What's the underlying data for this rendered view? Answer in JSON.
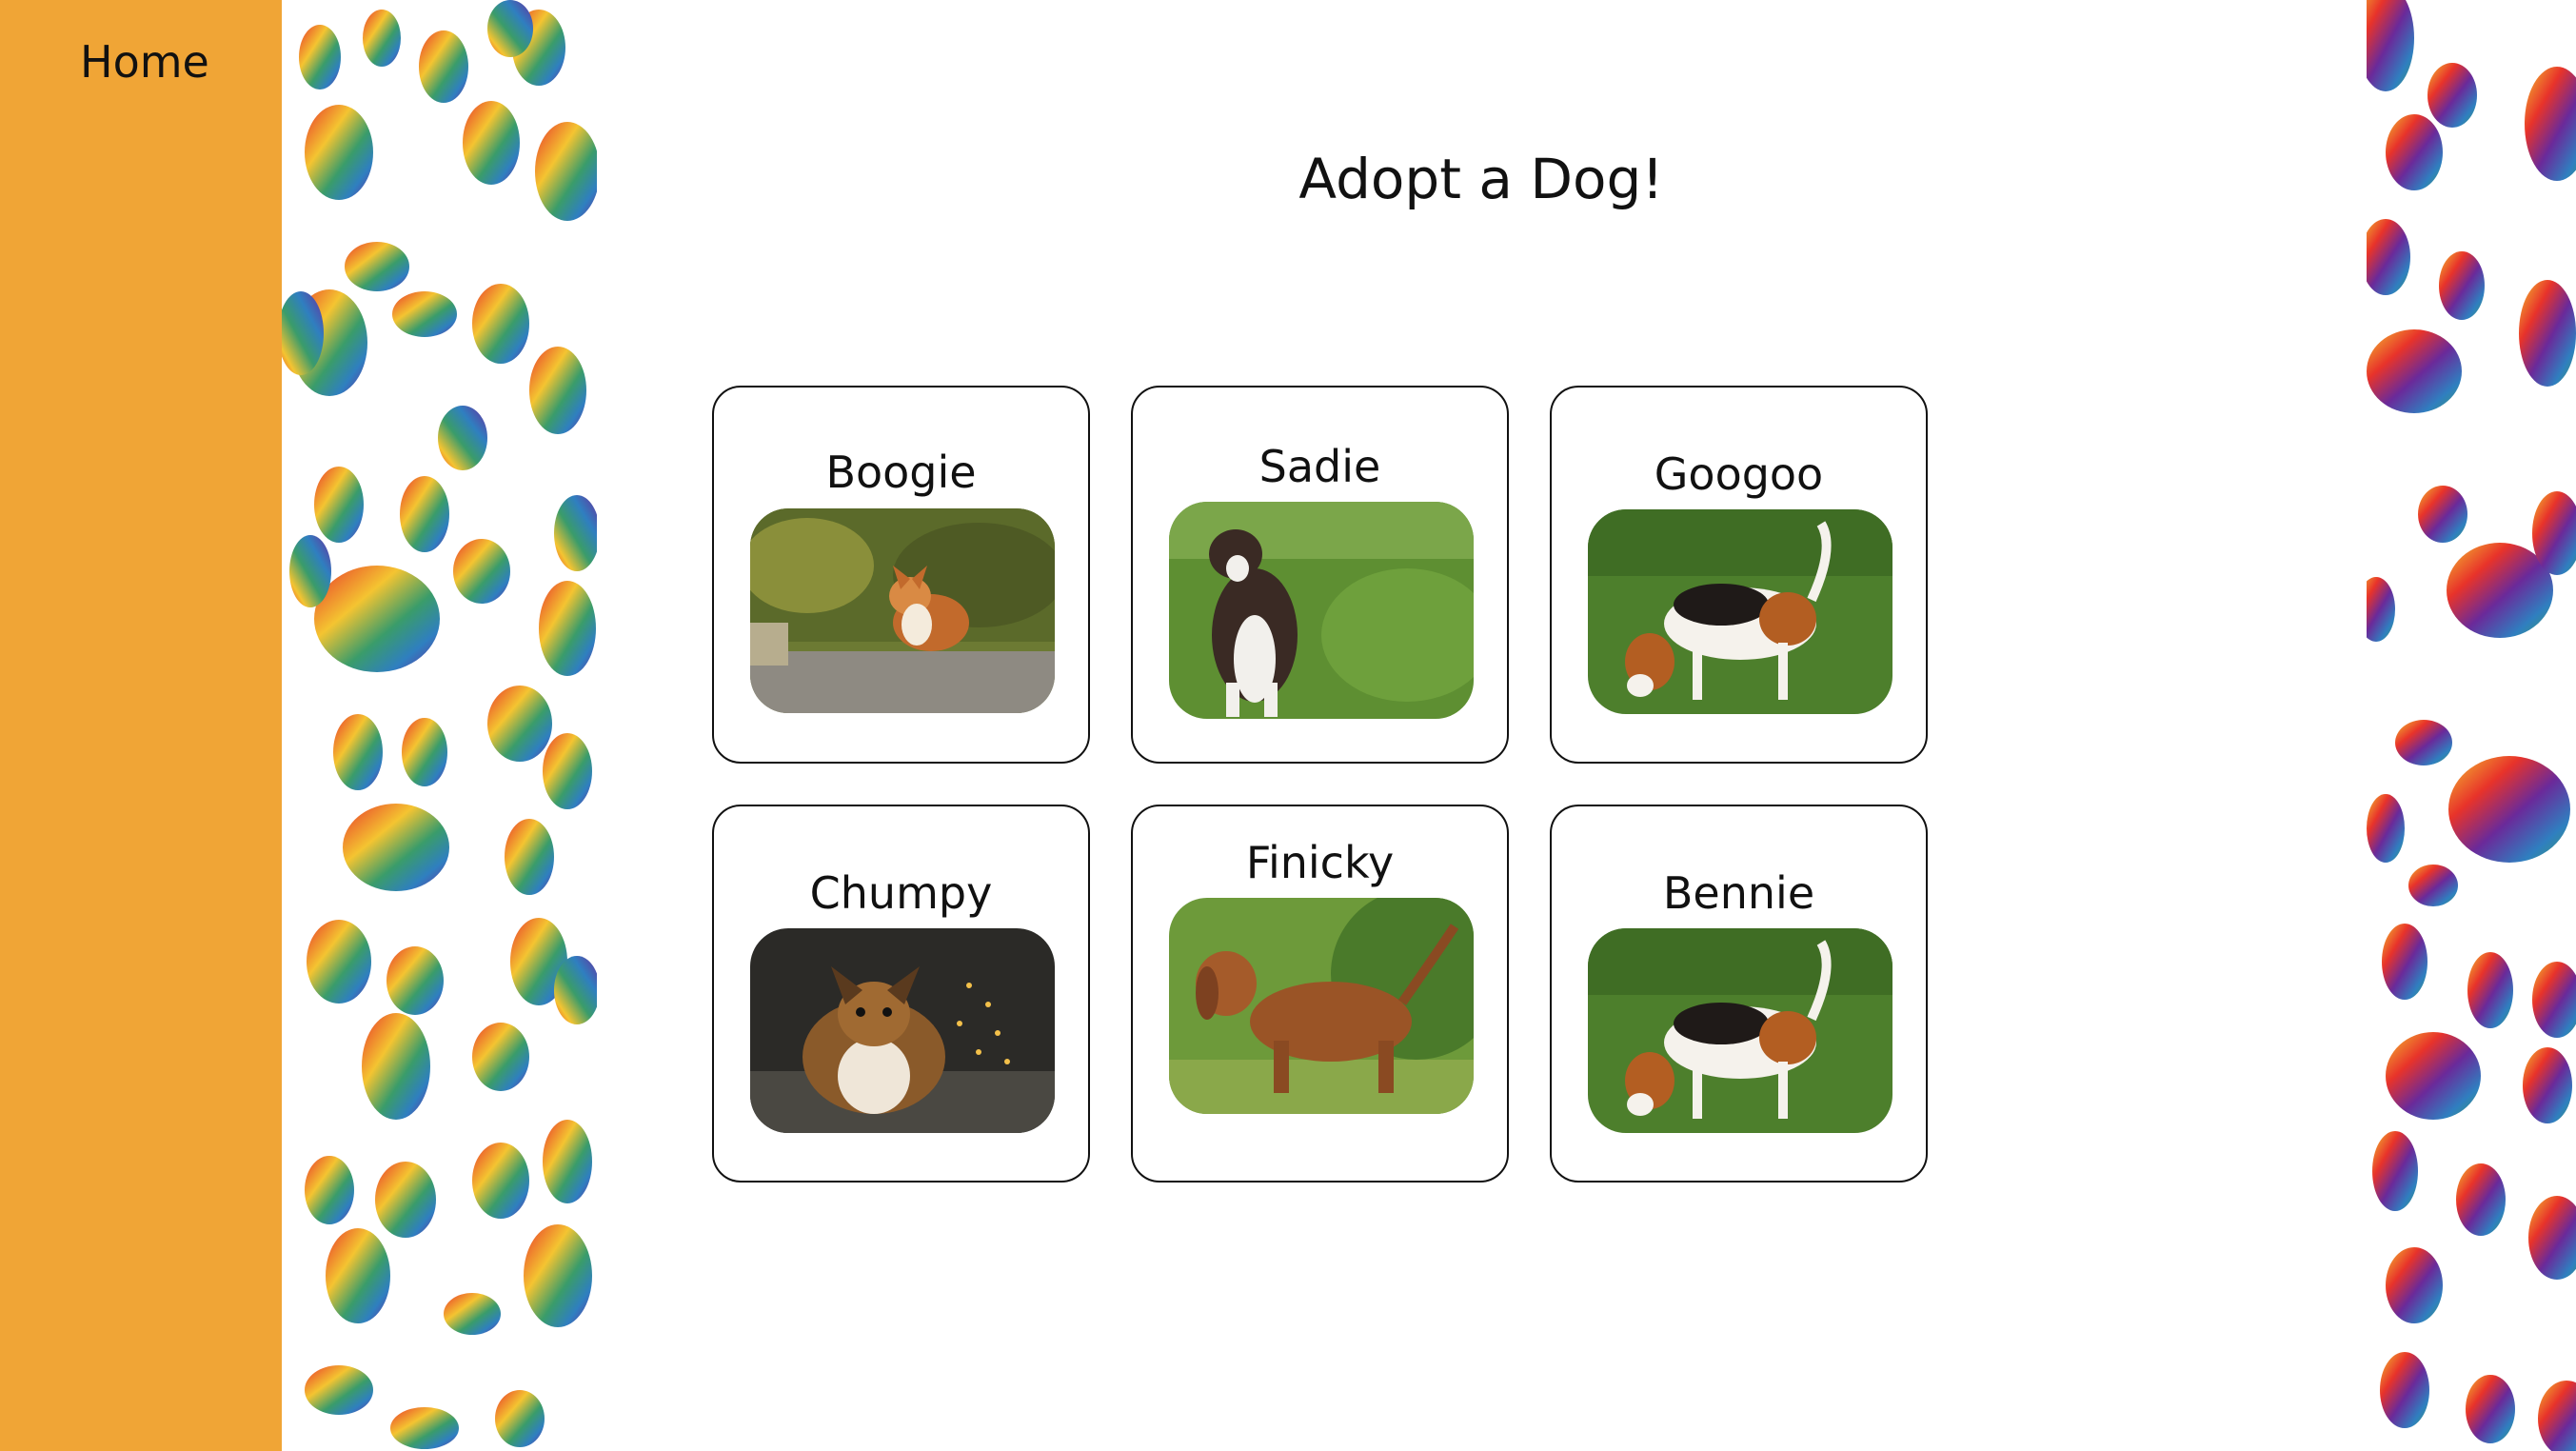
{
  "nav": {
    "home_label": "Home"
  },
  "page": {
    "title": "Adopt a Dog!"
  },
  "dogs": [
    {
      "name": "Boogie"
    },
    {
      "name": "Sadie"
    },
    {
      "name": "Googoo"
    },
    {
      "name": "Chumpy"
    },
    {
      "name": "Finicky"
    },
    {
      "name": "Bennie"
    }
  ],
  "colors": {
    "sidebar": "#f0a536",
    "card_border": "#111111",
    "paw_gradient": [
      "#e8332a",
      "#f4c431",
      "#3a9c6a",
      "#2f7fc0",
      "#6a2a9a"
    ]
  }
}
